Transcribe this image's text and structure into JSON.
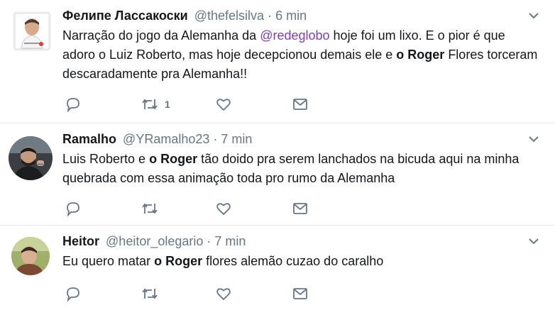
{
  "tweets": [
    {
      "name": "Фелипе Лассакоски",
      "handle": "@thefelsilva",
      "separator": "·",
      "time": "6 min",
      "text": {
        "p1": "Narração do jogo da Alemanha da ",
        "mention": "@redeglobo",
        "p2": " hoje foi um lixo. E o pior é que adoro o Luiz Roberto, mas hoje decepcionou demais ele e ",
        "bold": "o Roger",
        "p3": " Flores torceram descaradamente pra Alemanha!!"
      },
      "retweet_count": "1"
    },
    {
      "name": "Ramalho",
      "handle": "@YRamalho23",
      "separator": "·",
      "time": "7 min",
      "text": {
        "p1": "Luis Roberto e ",
        "bold": "o Roger",
        "p2": " tão doido pra serem lanchados na bicuda aqui na minha quebrada com essa animação toda pro rumo da Alemanha"
      }
    },
    {
      "name": "Heitor",
      "handle": "@heitor_olegario",
      "separator": "·",
      "time": "7 min",
      "text": {
        "p1": "Eu quero matar ",
        "bold": "o Roger",
        "p2": " flores alemão cuzao do caralho"
      }
    }
  ],
  "colors": {
    "icon": "#657786",
    "mention": "#7b3fb5",
    "divider": "#e6ecf0"
  },
  "icons": [
    "reply-icon",
    "retweet-icon",
    "like-icon",
    "direct-message-icon",
    "chevron-down-icon"
  ]
}
